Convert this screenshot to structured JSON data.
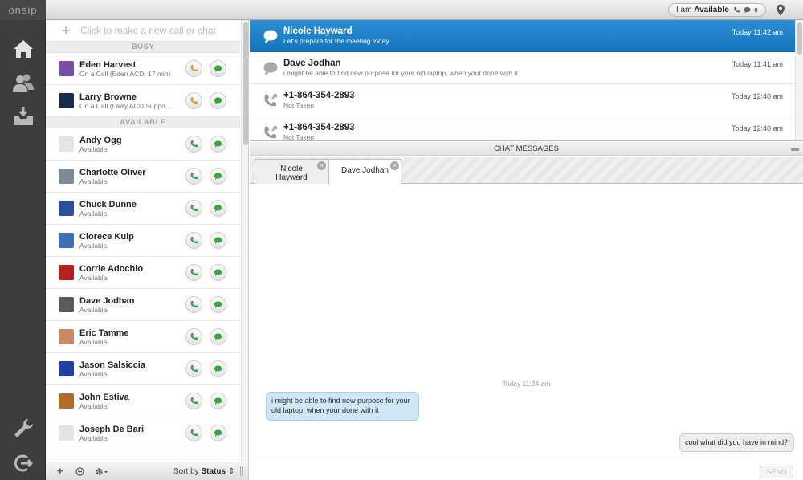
{
  "app": {
    "brand": "onsip"
  },
  "topbar": {
    "status_prefix": "I am",
    "status_value": "Available"
  },
  "contacts": {
    "new_call_placeholder": "Click to make a new call or chat",
    "busy_header": "BUSY",
    "available_header": "AVAILABLE",
    "busy": [
      {
        "name": "Eden Harvest",
        "status": "On a Call (Eden ACD: 17 min)",
        "avatar_color": "#7a4ea8"
      },
      {
        "name": "Larry Browne",
        "status": "On a Call (Larry ACD Suppo…",
        "avatar_color": "#1b2b4a"
      }
    ],
    "available": [
      {
        "name": "Andy Ogg",
        "status": "Available",
        "avatar_color": "#e4e4e4"
      },
      {
        "name": "Charlotte Oliver",
        "status": "Available",
        "avatar_color": "#7d8a96"
      },
      {
        "name": "Chuck Dunne",
        "status": "Available",
        "avatar_color": "#2c4f9c"
      },
      {
        "name": "Clorece Kulp",
        "status": "Available",
        "avatar_color": "#3e6fb6"
      },
      {
        "name": "Corrie Adochio",
        "status": "Available",
        "avatar_color": "#b3221c"
      },
      {
        "name": "Dave Jodhan",
        "status": "Available",
        "avatar_color": "#5a5a5a"
      },
      {
        "name": "Eric Tamme",
        "status": "Available",
        "avatar_color": "#c98a63"
      },
      {
        "name": "Jason Salsiccia",
        "status": "Available",
        "avatar_color": "#1d3fa6"
      },
      {
        "name": "John Estiva",
        "status": "Available",
        "avatar_color": "#b36b2a"
      },
      {
        "name": "Joseph De Bari",
        "status": "Available",
        "avatar_color": "#e4e4e4"
      }
    ]
  },
  "bottom": {
    "sort_prefix": "Sort by",
    "sort_value": "Status"
  },
  "calls": [
    {
      "title": "Nicole Hayward",
      "subtitle": "Let's prepare for the meeting today",
      "time": "Today 11:42 am",
      "kind": "chat",
      "active": true
    },
    {
      "title": "Dave Jodhan",
      "subtitle": "i might be able to find new purpose for your old laptop, when your done with it",
      "time": "Today 11:41 am",
      "kind": "chat",
      "active": false
    },
    {
      "title": "+1-864-354-2893",
      "subtitle": "Not Taken",
      "time": "Today 12:40 am",
      "kind": "call",
      "active": false
    },
    {
      "title": "+1-864-354-2893",
      "subtitle": "Not Taken",
      "time": "Today 12:40 am",
      "kind": "call",
      "active": false
    }
  ],
  "chat": {
    "header": "CHAT MESSAGES",
    "tabs": [
      {
        "label": "Nicole Hayward",
        "selected": false
      },
      {
        "label": "Dave Jodhan",
        "selected": true
      }
    ],
    "timestamp": "Today 11:34 am",
    "incoming": "i might be able to find new purpose for your old laptop, when your done with it",
    "outgoing": "cool what did you have in mind?",
    "send_label": "SEND"
  },
  "colors": {
    "accent_blue": "#1a7fc9",
    "call_green": "#3aa63a",
    "busy_orange": "#e59a3a"
  }
}
